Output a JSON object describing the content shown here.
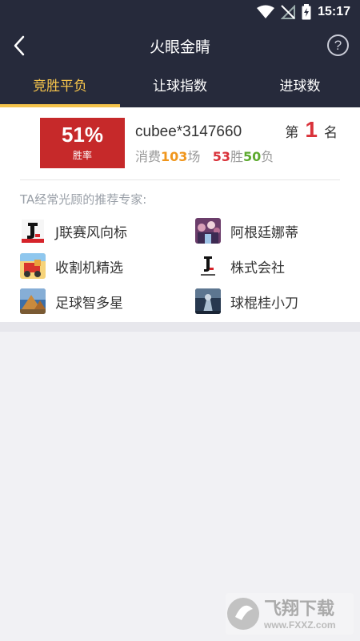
{
  "status_bar": {
    "time": "15:17"
  },
  "header": {
    "title": "火眼金睛",
    "help_label": "?"
  },
  "tabs": [
    {
      "label": "竞胜平负",
      "active": true
    },
    {
      "label": "让球指数",
      "active": false
    },
    {
      "label": "进球数",
      "active": false
    }
  ],
  "profile": {
    "win_rate": "51%",
    "win_rate_label": "胜率",
    "username": "cubee*3147660",
    "spend_prefix": "消费",
    "spend_count": "103",
    "spend_suffix": "场",
    "wins": "53",
    "wins_label": "胜",
    "losses": "50",
    "losses_label": "负",
    "rank_prefix": "第",
    "rank": "1",
    "rank_suffix": "名"
  },
  "experts_section": {
    "title": "TA经常光顾的推荐专家:",
    "items": [
      {
        "name": "J联赛风向标",
        "avatar": "j-league-logo"
      },
      {
        "name": "阿根廷娜蒂",
        "avatar": "crowd-photo"
      },
      {
        "name": "收割机精选",
        "avatar": "harvester-photo"
      },
      {
        "name": "株式会社",
        "avatar": "j-league-logo-white"
      },
      {
        "name": "足球智多星",
        "avatar": "pyramid-photo"
      },
      {
        "name": "球棍桂小刀",
        "avatar": "night-photo"
      }
    ]
  },
  "watermark": {
    "brand": "飞翔下载",
    "url": "www.FXXZ.com"
  },
  "colors": {
    "header_bg": "#262a3b",
    "accent": "#f4c34b",
    "rate_bg": "#c6292a",
    "orange": "#f0961c",
    "red": "#d9323a",
    "green": "#5daa2f"
  }
}
